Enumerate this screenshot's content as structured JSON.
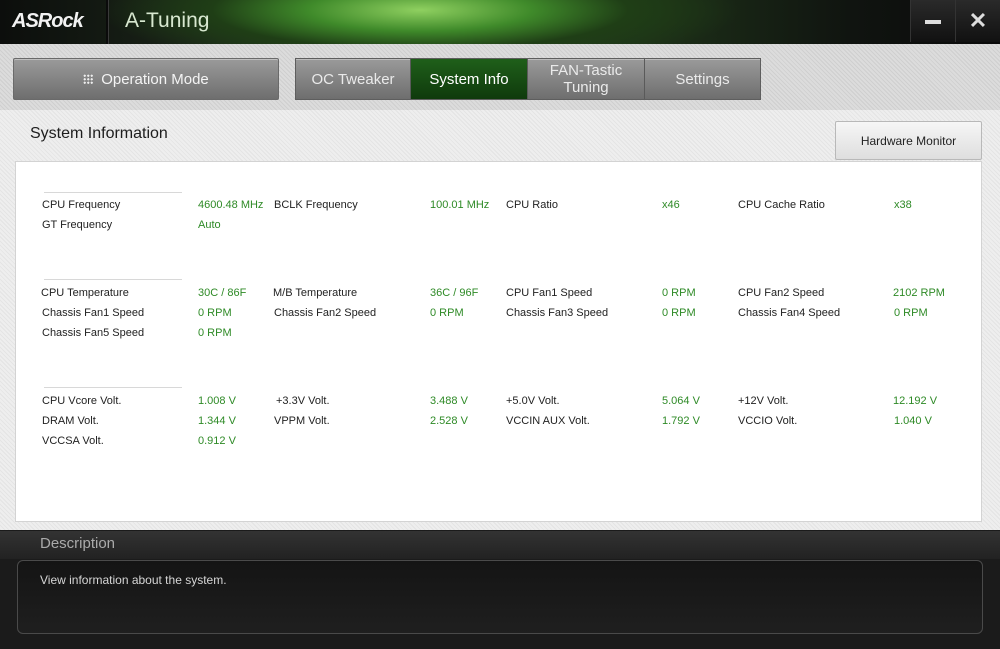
{
  "titlebar": {
    "logo": "ASRock",
    "app_title": "A-Tuning",
    "minimize_label": "",
    "close_label": "✕"
  },
  "nav": {
    "operation_mode": "Operation Mode",
    "tabs": [
      {
        "label": "OC Tweaker",
        "active": false
      },
      {
        "label": "System Info",
        "active": true
      },
      {
        "label": "FAN-Tastic Tuning",
        "active": false
      },
      {
        "label": "Settings",
        "active": false
      }
    ]
  },
  "main": {
    "title": "System Information",
    "hardware_monitor": "Hardware Monitor",
    "freq": {
      "cpu_freq_label": "CPU Frequency",
      "cpu_freq_value": "4600.48 MHz",
      "bclk_label": "BCLK Frequency",
      "bclk_value": "100.01 MHz",
      "cpu_ratio_label": "CPU Ratio",
      "cpu_ratio_value": "x46",
      "cache_ratio_label": "CPU Cache Ratio",
      "cache_ratio_value": "x38",
      "gt_freq_label": "GT Frequency",
      "gt_freq_value": "Auto"
    },
    "temps": {
      "cpu_temp_label": "CPU Temperature",
      "cpu_temp_value": "30C / 86F",
      "mb_temp_label": "M/B Temperature",
      "mb_temp_value": "36C / 96F",
      "cpu_fan1_label": "CPU Fan1 Speed",
      "cpu_fan1_value": "0 RPM",
      "cpu_fan2_label": "CPU Fan2 Speed",
      "cpu_fan2_value": "2102 RPM",
      "chassis_fan1_label": "Chassis Fan1 Speed",
      "chassis_fan1_value": "0 RPM",
      "chassis_fan2_label": "Chassis Fan2 Speed",
      "chassis_fan2_value": "0 RPM",
      "chassis_fan3_label": "Chassis Fan3 Speed",
      "chassis_fan3_value": "0 RPM",
      "chassis_fan4_label": "Chassis Fan4 Speed",
      "chassis_fan4_value": "0 RPM",
      "chassis_fan5_label": "Chassis Fan5 Speed",
      "chassis_fan5_value": "0 RPM"
    },
    "volts": {
      "vcore_label": "CPU Vcore Volt.",
      "vcore_value": "1.008 V",
      "v33_label": "+3.3V Volt.",
      "v33_value": "3.488 V",
      "v50_label": "+5.0V Volt.",
      "v50_value": "5.064 V",
      "v12_label": "+12V Volt.",
      "v12_value": "12.192 V",
      "dram_label": "DRAM Volt.",
      "dram_value": "1.344 V",
      "vppm_label": "VPPM Volt.",
      "vppm_value": "2.528 V",
      "vccin_label": "VCCIN AUX Volt.",
      "vccin_value": "1.792 V",
      "vccio_label": "VCCIO Volt.",
      "vccio_value": "1.040 V",
      "vccsa_label": "VCCSA Volt.",
      "vccsa_value": "0.912 V"
    }
  },
  "description": {
    "title": "Description",
    "text": "View information about the system."
  },
  "colors": {
    "accent_green": "#1f5f1a",
    "value_green": "#2e8a26"
  }
}
